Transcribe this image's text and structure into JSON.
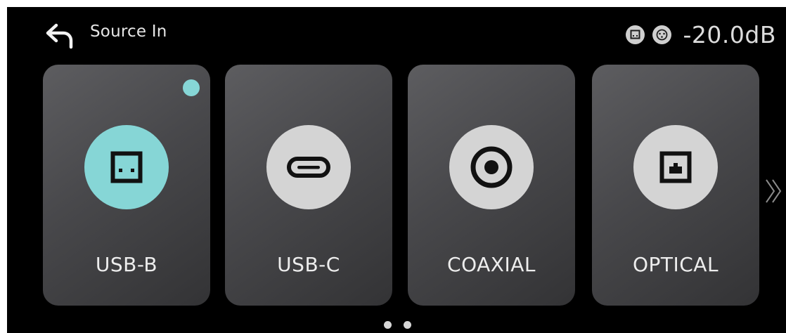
{
  "header": {
    "title": "Source In",
    "back_icon": "back-arrow-icon",
    "status_icons": [
      "usb-b-status-icon",
      "xlr-status-icon"
    ],
    "volume": "-20.0dB"
  },
  "sources": [
    {
      "label": "USB-B",
      "icon": "usb-b-icon",
      "selected": true
    },
    {
      "label": "USB-C",
      "icon": "usb-c-icon",
      "selected": false
    },
    {
      "label": "COAXIAL",
      "icon": "coaxial-icon",
      "selected": false
    },
    {
      "label": "OPTICAL",
      "icon": "optical-icon",
      "selected": false
    }
  ],
  "pager": {
    "pages": 2,
    "current": 1
  },
  "colors": {
    "accent": "#86d6d6",
    "background": "#000000",
    "card": "#4a4a4d",
    "icon_bg": "#d4d4d4"
  }
}
